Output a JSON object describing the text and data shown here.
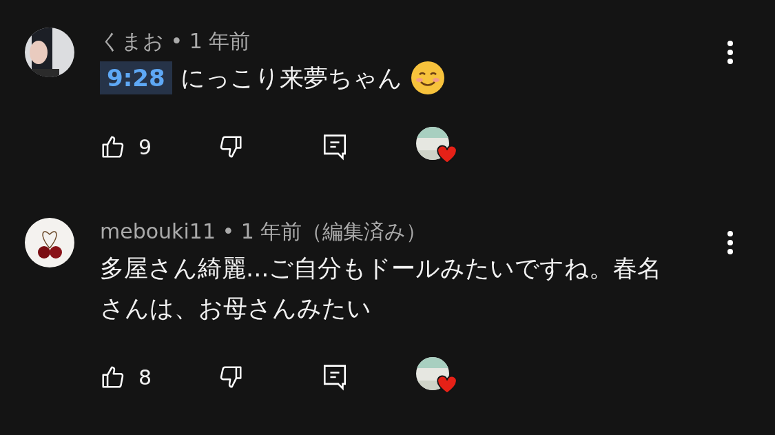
{
  "comments": [
    {
      "header": "くまお • 1 年前",
      "timestamp": "9:28",
      "text": "にっこり来夢ちゃん",
      "emoji": true,
      "likes": "9",
      "hearted": true
    },
    {
      "header": "mebouki11 • 1 年前（編集済み）",
      "text": "多屋さん綺麗...ご自分もドールみたいですね。春名さんは、お母さんみたい",
      "emoji": false,
      "likes": "8",
      "hearted": true
    }
  ]
}
